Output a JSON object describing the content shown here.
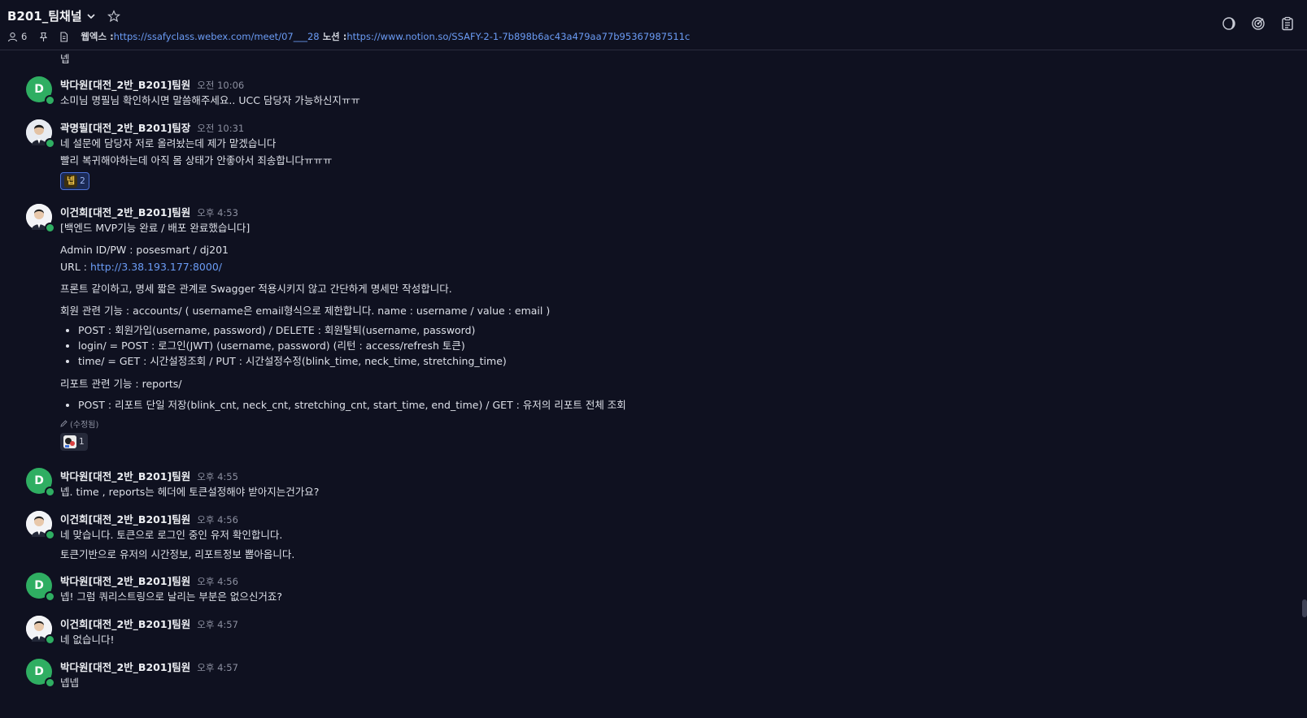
{
  "header": {
    "channel_title": "B201_팀채널",
    "member_count": "6",
    "topic_label_webex": "웹엑스 : ",
    "topic_link_webex": "https://ssafyclass.webex.com/meet/07___28",
    "topic_label_notion": "노션 : ",
    "topic_link_notion": "https://www.notion.so/SSAFY-2-1-7b898b6ac43a479aa77b95367987511c"
  },
  "messages": [
    {
      "continued_text": "넵"
    },
    {
      "author": "박다원[대전_2반_B201]팀원",
      "avatar_letter": "D",
      "time": "오전 10:06",
      "lines": [
        "소미님 명필님 확인하시면 말씀해주세요.. UCC 담당자 가능하신지ㅠㅠ"
      ]
    },
    {
      "author": "곽명필[대전_2반_B201]팀장",
      "time": "오전 10:31",
      "lines": [
        "네 설문에 담당자 저로 올려놨는데 제가 맡겠습니다",
        "빨리 복귀해야하는데 아직 몸 상태가 안좋아서 죄송합니다ㅠㅠㅠ"
      ],
      "reaction": {
        "emoji_text": "넵",
        "count": "2"
      }
    },
    {
      "author": "이건희[대전_2반_B201]팀원",
      "time": "오후 4:53",
      "title_line": "[백엔드 MVP기능 완료 / 배포 완료했습니다]",
      "admin_line": "Admin ID/PW : posesmart / dj201",
      "url_label": "URL : ",
      "url_link": "http://3.38.193.177:8000/",
      "note_line": "프론트 같이하고, 명세 짧은 관계로 Swagger 적용시키지 않고 간단하게 명세만 작성합니다.",
      "accounts_line": "회원 관련 기능 : accounts/  ( username은 email형식으로 제한합니다. name : username / value : email )",
      "accounts_items": [
        "POST : 회원가입(username, password) / DELETE : 회원탈퇴(username, password)",
        "login/ = POST : 로그인(JWT) (username, password) (리턴 : access/refresh 토큰)",
        "time/ = GET : 시간설정조회 / PUT : 시간설정수정(blink_time, neck_time, stretching_time)"
      ],
      "reports_line": "리포트 관련 기능 : reports/",
      "reports_items": [
        "POST : 리포트 단일 저장(blink_cnt, neck_cnt, stretching_cnt, start_time, end_time) / GET : 유저의 리포트 전체 조회"
      ],
      "edited": "(수정됨)",
      "reaction": {
        "count": "1"
      }
    },
    {
      "author": "박다원[대전_2반_B201]팀원",
      "avatar_letter": "D",
      "time": "오후 4:55",
      "lines": [
        "넵. time , reports는 헤더에 토큰설정해야 받아지는건가요?"
      ]
    },
    {
      "author": "이건희[대전_2반_B201]팀원",
      "time": "오후 4:56",
      "lines": [
        "네 맞습니다. 토큰으로 로그인 중인 유저 확인합니다.",
        "토큰기반으로 유저의 시간정보, 리포트정보 뽑아옵니다."
      ]
    },
    {
      "author": "박다원[대전_2반_B201]팀원",
      "avatar_letter": "D",
      "time": "오후 4:56",
      "lines": [
        "넵! 그럼 쿼리스트링으로 날리는 부분은 없으신거죠?"
      ]
    },
    {
      "author": "이건희[대전_2반_B201]팀원",
      "time": "오후 4:57",
      "lines": [
        "네 없습니다!"
      ]
    },
    {
      "author": "박다원[대전_2반_B201]팀원",
      "avatar_letter": "D",
      "time": "오후 4:57",
      "lines": [
        "넵넵"
      ]
    }
  ],
  "colors": {
    "background": "#0f1120",
    "link": "#6b9cf5",
    "avatar_green": "#2fae62"
  },
  "icons": [
    "chevron-down-icon",
    "star-icon",
    "members-icon",
    "pin-icon",
    "document-icon",
    "moon-icon",
    "target-icon",
    "clipboard-icon",
    "pencil-icon"
  ]
}
